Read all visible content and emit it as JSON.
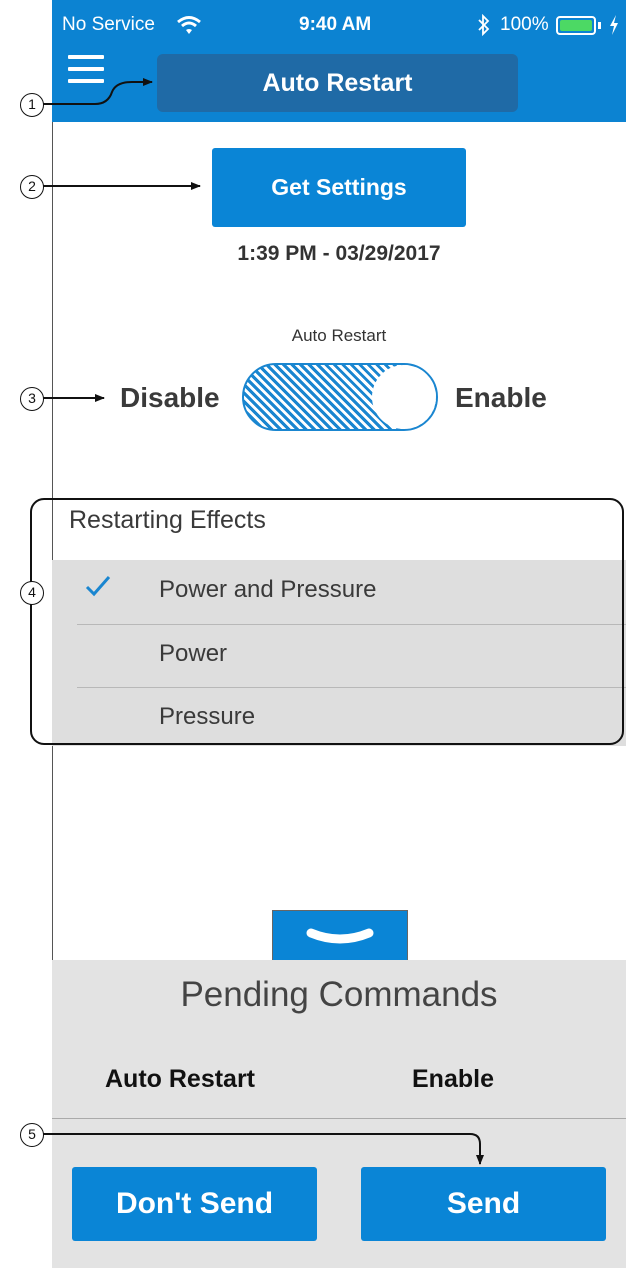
{
  "status_bar": {
    "carrier": "No Service",
    "time": "9:40 AM",
    "battery": "100%",
    "icons": [
      "wifi-icon",
      "bluetooth-icon",
      "battery-icon",
      "charging-icon"
    ]
  },
  "header": {
    "menu_icon": "hamburger-menu-icon",
    "title": "Auto Restart",
    "background": "#0c83d2"
  },
  "settings": {
    "button_label": "Get Settings",
    "timestamp": "1:39 PM - 03/29/2017"
  },
  "toggle": {
    "label": "Auto Restart",
    "off_label": "Disable",
    "on_label": "Enable",
    "state": "on"
  },
  "effects": {
    "title": "Restarting Effects",
    "items": [
      {
        "label": "Power and Pressure",
        "selected": true
      },
      {
        "label": "Power",
        "selected": false
      },
      {
        "label": "Pressure",
        "selected": false
      }
    ]
  },
  "pending": {
    "title": "Pending Commands",
    "command": "Auto Restart",
    "value": "Enable",
    "dont_send_label": "Don't Send",
    "send_label": "Send"
  },
  "callouts": [
    "1",
    "2",
    "3",
    "4",
    "5"
  ],
  "colors": {
    "accent": "#0a85d6",
    "title_box": "#1f6aa6",
    "list_bg": "#dedede",
    "pending_bg": "#e3e3e3"
  }
}
